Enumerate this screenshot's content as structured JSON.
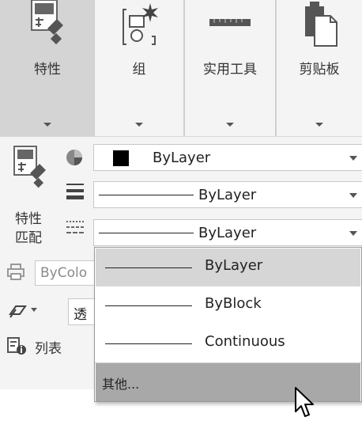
{
  "ribbon": {
    "groups": [
      {
        "label": "特性"
      },
      {
        "label": "组"
      },
      {
        "label": "实用工具"
      },
      {
        "label": "剪贴板"
      }
    ]
  },
  "panel": {
    "match_properties_label_line1": "特性",
    "match_properties_label_line2": "匹配",
    "color_combo": {
      "value": "ByLayer",
      "swatch_color": "#000000"
    },
    "lineweight_combo": {
      "value": "ByLayer"
    },
    "linetype_combo": {
      "value": "ByLayer"
    },
    "plotstyle_value": "ByColo",
    "transparency_value": "透",
    "list_label": "列表"
  },
  "linetype_dropdown": {
    "items": [
      {
        "label": "ByLayer",
        "selected": true
      },
      {
        "label": "ByBlock",
        "selected": false
      },
      {
        "label": "Continuous",
        "selected": false
      }
    ],
    "other_label": "其他..."
  }
}
